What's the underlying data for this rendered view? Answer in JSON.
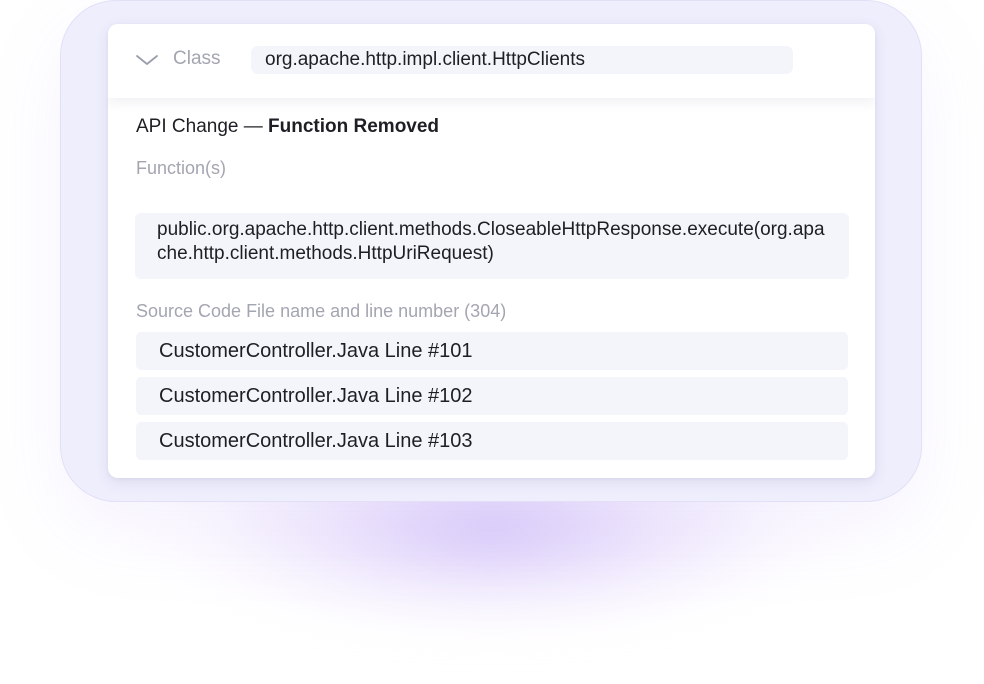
{
  "header": {
    "class_label": "Class",
    "class_value": "org.apache.http.impl.client.HttpClients"
  },
  "api_change": {
    "prefix": "API Change — ",
    "type": "Function Removed"
  },
  "functions": {
    "label": "Function(s)",
    "value": "public.org.apache.http.client.methods.CloseableHttpResponse.execute(org.apache.http.client.methods.HttpUriRequest)"
  },
  "source_files": {
    "label": "Source Code File name and line number (304)",
    "items": [
      "CustomerController.Java Line #101",
      "CustomerController.Java Line #102",
      "CustomerController.Java Line #103"
    ]
  },
  "icons": {
    "collapse": "chevron-down-icon"
  },
  "colors": {
    "frame": "#eeeefd",
    "glow": "#baa0f5",
    "muted_text": "#a3a6b1",
    "field_bg": "#f4f5fa"
  }
}
